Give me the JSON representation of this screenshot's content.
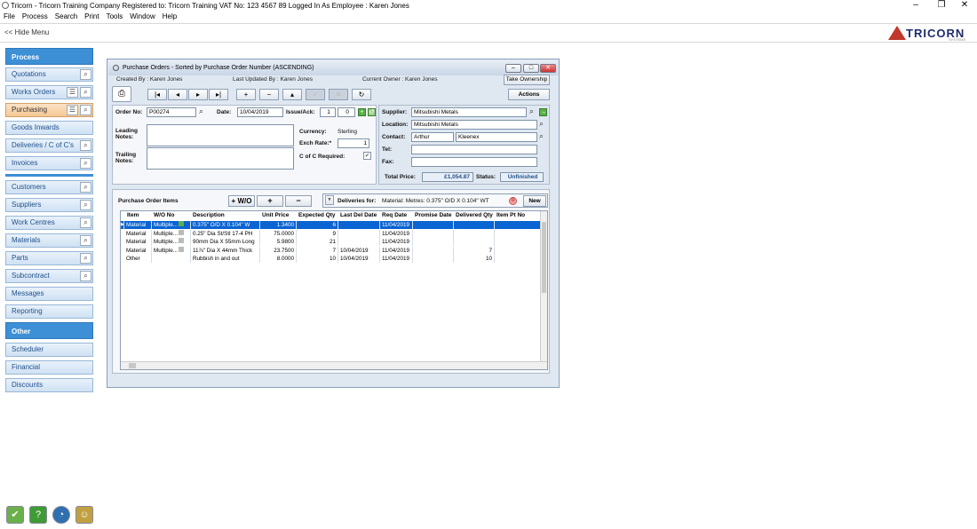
{
  "app": {
    "title": "Tricorn - Tricorn Training Company   Registered to: Tricorn Training    VAT No: 123 4567 89    Logged In As Employee : Karen Jones",
    "menu": [
      "File",
      "Process",
      "Search",
      "Print",
      "Tools",
      "Window",
      "Help"
    ],
    "hide_menu": "<< Hide Menu",
    "logo": "TRICORN",
    "logo_sub": "SYSTEMS"
  },
  "sidebar": {
    "process_header": "Process",
    "process_items": [
      "Quotations",
      "Works Orders",
      "Purchasing",
      "Goods Inwards",
      "Deliveries / C of C's",
      "Invoices"
    ],
    "maint_items": [
      "Customers",
      "Suppliers",
      "Work Centres",
      "Materials",
      "Parts",
      "Subcontract",
      "Messages",
      "Reporting"
    ],
    "other_header": "Other",
    "other_items": [
      "Scheduler",
      "Financial",
      "Discounts"
    ]
  },
  "window": {
    "title": "Purchase Orders - Sorted by Purchase Order Number (ASCENDING)",
    "created_by": "Created By :  Karen Jones",
    "last_updated_by": "Last Updated By :  Karen Jones",
    "current_owner": "Current Owner :  Karen Jones",
    "take_ownership": "Take Ownership",
    "actions": "Actions"
  },
  "header": {
    "order_no_label": "Order No:",
    "order_no": "P00274",
    "date_label": "Date:",
    "date": "10/04/2019",
    "issue_label": "Issue/Ack:",
    "issue": "1",
    "ack": "0",
    "leading_notes_label": "Leading Notes:",
    "trailing_notes_label": "Trailing Notes:",
    "currency_label": "Currency:",
    "currency": "Sterling",
    "exch_rate_label": "Exch Rate:*",
    "exch_rate": "1",
    "cofc_label": "C of C Required:",
    "cofc_check": "✓",
    "supplier_label": "Supplier:",
    "supplier": "Mitsubishi Metals",
    "location_label": "Location:",
    "location": "Mitsubishi Metals",
    "contact_label": "Contact:",
    "contact_first": "Arthur",
    "contact_last": "Kleenex",
    "tel_label": "Tel:",
    "fax_label": "Fax:",
    "total_price_label": "Total Price:",
    "total_price": "£1,054.87",
    "status_label": "Status:",
    "status": "Unfinished"
  },
  "items": {
    "title": "Purchase Order Items",
    "wo_button": "+ W/O",
    "add_button": "+",
    "remove_button": "−",
    "deliveries_label": "Deliveries for:",
    "deliveries_for": "Material: Metres: 0.375\" O/D X 0.104\" WT",
    "deliveries_count": "0",
    "new_button": "New",
    "columns": [
      "Item",
      "W/O No",
      "Description",
      "Unit Price",
      "Expected Qty",
      "Last Del Date",
      "Req Date",
      "Promise Date",
      "Delivered Qty",
      "Item Pt No"
    ],
    "rows": [
      [
        "Material",
        "Multiple...",
        "0.375\" O/D X 0.104\" W",
        "1.3400",
        "6",
        "",
        "11/04/2019",
        "",
        "",
        ""
      ],
      [
        "Material",
        "Multiple...",
        "0.25\" Dia St/Stl 17-4 PH",
        "75.0000",
        "9",
        "",
        "11/04/2019",
        "",
        "",
        ""
      ],
      [
        "Material",
        "Multiple...",
        "90mm Dia X 55mm Long",
        "5.9800",
        "21",
        "",
        "11/04/2019",
        "",
        "",
        ""
      ],
      [
        "Material",
        "Multiple...",
        "11⅞\" Dia X 44mm Thick",
        "23.7500",
        "7",
        "10/04/2019",
        "11/04/2019",
        "",
        "7",
        ""
      ],
      [
        "Other",
        "",
        "Rubbish in and out",
        "8.0000",
        "10",
        "10/04/2019",
        "11/04/2019",
        "",
        "10",
        ""
      ]
    ]
  }
}
